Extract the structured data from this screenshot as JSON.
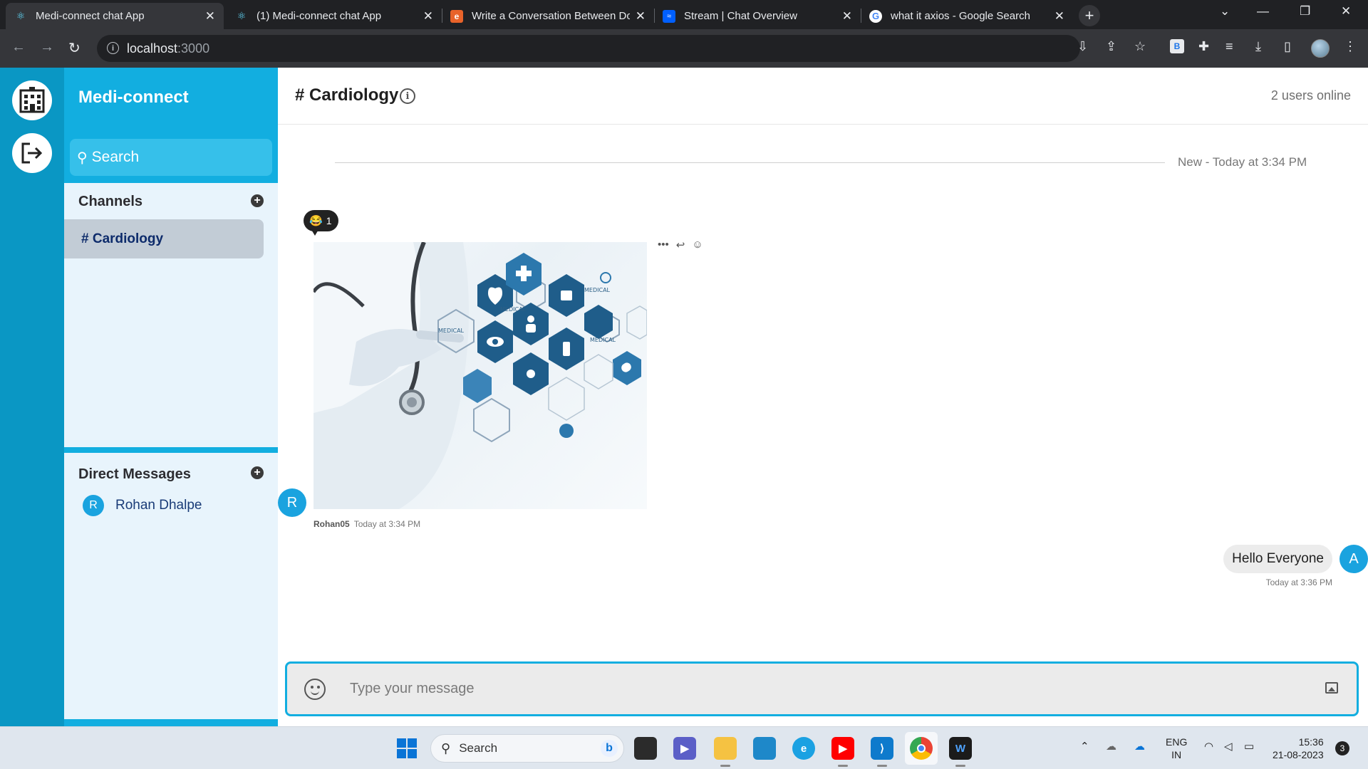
{
  "browser": {
    "tabs": [
      {
        "label": "Medi-connect chat App",
        "active": true
      },
      {
        "label": "(1) Medi-connect chat App",
        "active": false
      },
      {
        "label": "Write a Conversation Between Do",
        "active": false
      },
      {
        "label": "Stream | Chat Overview",
        "active": false
      },
      {
        "label": "what it axios - Google Search",
        "active": false
      }
    ],
    "url_host": "localhost",
    "url_port": ":3000"
  },
  "sidebar": {
    "brand": "Medi-connect",
    "search_placeholder": "Search",
    "channels_title": "Channels",
    "channels": [
      {
        "label": "# Cardiology",
        "active": true
      }
    ],
    "dm_title": "Direct Messages",
    "direct_messages": [
      {
        "initial": "R",
        "name": "Rohan Dhalpe"
      }
    ]
  },
  "channel": {
    "title": "# Cardiology",
    "users_online": "2 users online",
    "date_separator": "New - Today at 3:34 PM"
  },
  "messages": [
    {
      "type": "image",
      "author_initial": "R",
      "author": "Rohan05",
      "time": "Today at 3:34 PM",
      "reaction": {
        "emoji": "😂",
        "count": "1"
      },
      "image_labels": [
        "MEDICAL",
        "MEDICAL",
        "MEDICAL",
        "MEDICAL"
      ]
    },
    {
      "type": "text",
      "author_initial": "A",
      "text": "Hello Everyone",
      "time": "Today at 3:36 PM",
      "mine": true
    }
  ],
  "composer": {
    "placeholder": "Type your message"
  },
  "taskbar": {
    "search_label": "Search",
    "lang_line1": "ENG",
    "lang_line2": "IN",
    "time": "15:36",
    "date": "21-08-2023",
    "notification_count": "3"
  },
  "colors": {
    "rail": "#0a97c4",
    "brand_header": "#12aee0",
    "sidebar_bg": "#e8f4fc",
    "avatar": "#1aa3df",
    "composer_border": "#12aee0"
  }
}
